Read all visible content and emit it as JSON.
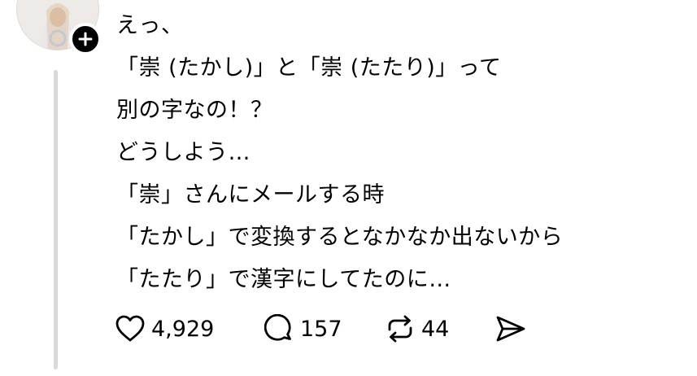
{
  "post": {
    "lines": [
      "えっ、",
      "「崇 (たかし)」と「崇 (たたり)」って",
      "別の字なの！？",
      "どうしよう…",
      "「崇」さんにメールする時",
      "「たかし」で変換するとなかなか出ないから",
      "「たたり」で漢字にしてたのに…"
    ]
  },
  "actions": {
    "likes": "4,929",
    "replies": "157",
    "reposts": "44"
  },
  "icons": {
    "follow": "plus-icon",
    "like": "heart-icon",
    "reply": "reply-icon",
    "repost": "repost-icon",
    "share": "send-icon"
  },
  "colors": {
    "text": "#000000",
    "thread_line": "#d9d9d9",
    "badge": "#000000"
  }
}
